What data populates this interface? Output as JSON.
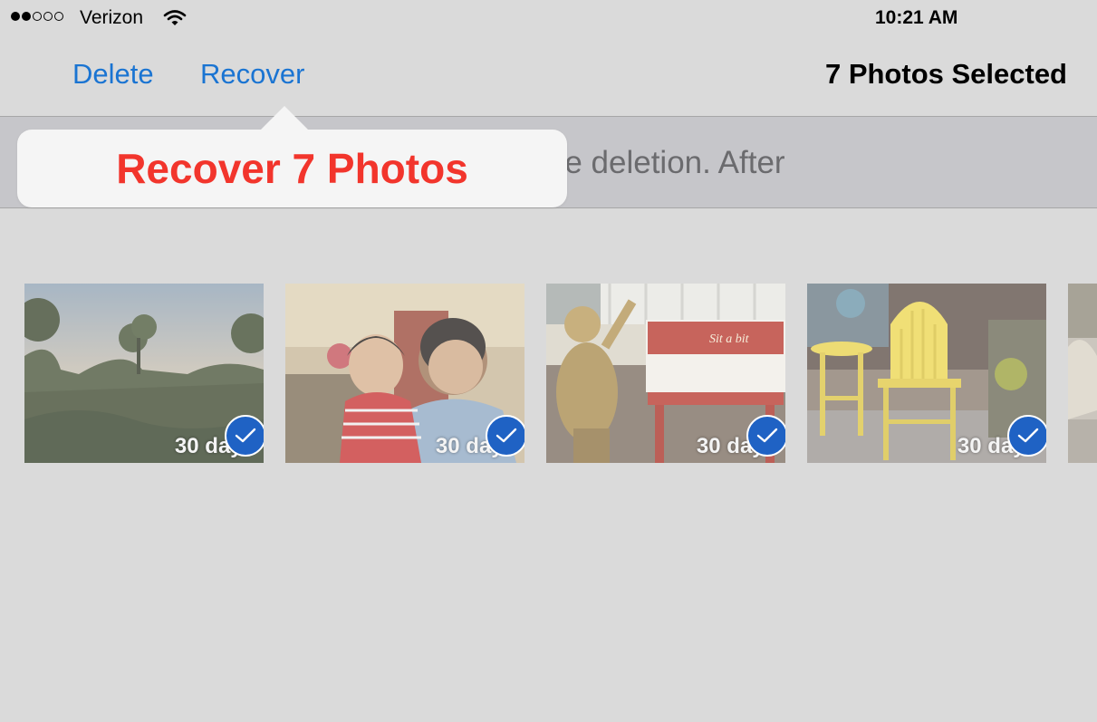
{
  "status_bar": {
    "signal_icon": "signal-dots-icon",
    "signal_strength": 2,
    "signal_total": 5,
    "carrier": "Verizon",
    "wifi_icon": "wifi-icon",
    "time": "10:21 AM"
  },
  "nav": {
    "delete_label": "Delete",
    "recover_label": "Recover",
    "title": "7 Photos Selected"
  },
  "banner": {
    "text": "Photos show the days remaining before deletion. After"
  },
  "popover": {
    "action_label": "Recover 7 Photos"
  },
  "accent_colors": {
    "link_blue": "#1a74d2",
    "destructive_red": "#f2352c",
    "check_blue": "#1f62c4"
  },
  "photos": [
    {
      "days_label": "30 days",
      "selected": true,
      "subject": "field landscape at sunset"
    },
    {
      "days_label": "30 days",
      "selected": true,
      "subject": "man holding child indoors"
    },
    {
      "days_label": "30 days",
      "selected": true,
      "subject": "golden statue beside red bench"
    },
    {
      "days_label": "30 days",
      "selected": true,
      "subject": "yellow chair and table"
    }
  ]
}
